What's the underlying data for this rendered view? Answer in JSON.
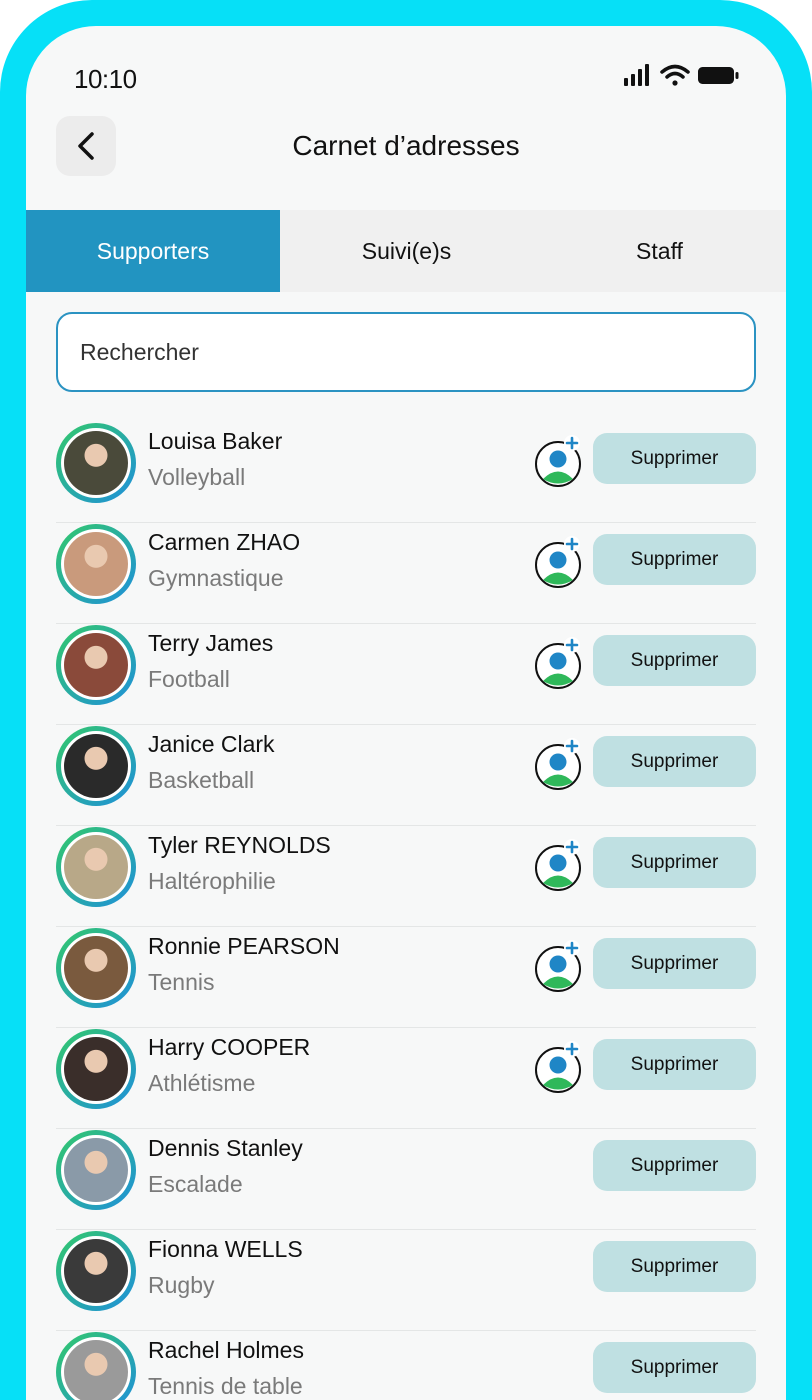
{
  "status_bar": {
    "time": "10:10"
  },
  "header": {
    "title": "Carnet d’adresses"
  },
  "tabs": [
    {
      "label": "Supporters",
      "active": true
    },
    {
      "label": "Suivi(e)s",
      "active": false
    },
    {
      "label": "Staff",
      "active": false
    }
  ],
  "search": {
    "placeholder": "Rechercher"
  },
  "contacts": [
    {
      "name": "Louisa Baker",
      "sport": "Volleyball",
      "add_icon": true,
      "photo": "#4a4a3a"
    },
    {
      "name": "Carmen ZHAO",
      "sport": "Gymnastique",
      "add_icon": true,
      "photo": "#c99a7c"
    },
    {
      "name": "Terry James",
      "sport": "Football",
      "add_icon": true,
      "photo": "#8a4a3a"
    },
    {
      "name": "Janice Clark",
      "sport": "Basketball",
      "add_icon": true,
      "photo": "#2a2a2a"
    },
    {
      "name": "Tyler REYNOLDS",
      "sport": "Haltérophilie",
      "add_icon": true,
      "photo": "#b8a888"
    },
    {
      "name": "Ronnie PEARSON",
      "sport": "Tennis",
      "add_icon": true,
      "photo": "#7a5a3e"
    },
    {
      "name": "Harry COOPER",
      "sport": "Athlétisme",
      "add_icon": true,
      "photo": "#3a2e2a"
    },
    {
      "name": "Dennis Stanley",
      "sport": "Escalade",
      "add_icon": false,
      "photo": "#8a9aa8"
    },
    {
      "name": "Fionna WELLS",
      "sport": "Rugby",
      "add_icon": false,
      "photo": "#3a3a3a"
    },
    {
      "name": "Rachel Holmes",
      "sport": "Tennis de table",
      "add_icon": false,
      "photo": "#9a9a9a"
    }
  ],
  "delete_label": "Supprimer",
  "colors": {
    "frame": "#06e0f7",
    "accent": "#2294c1",
    "delete_bg": "#bfe0e2",
    "add_icon_blue": "#1f86c6",
    "add_icon_green": "#2fb85a"
  }
}
